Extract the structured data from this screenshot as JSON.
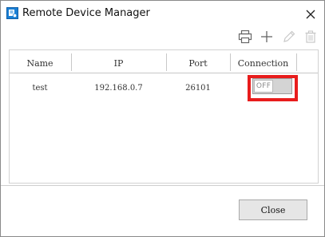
{
  "window": {
    "title": "Remote Device Manager"
  },
  "icons": {
    "app": "device-manager-icon",
    "close": "close-icon",
    "toolbar": [
      "print-icon",
      "add-icon",
      "edit-icon",
      "delete-icon"
    ]
  },
  "table": {
    "columns": [
      "Name",
      "IP",
      "Port",
      "Connection"
    ],
    "rows": [
      {
        "name": "test",
        "ip": "192.168.0.7",
        "port": "26101",
        "connection": "OFF"
      }
    ]
  },
  "footer": {
    "close_label": "Close"
  },
  "colors": {
    "highlight": "#e81c1c",
    "toggle_track": "#d4d4d4",
    "button_bg": "#e6e6e6"
  }
}
